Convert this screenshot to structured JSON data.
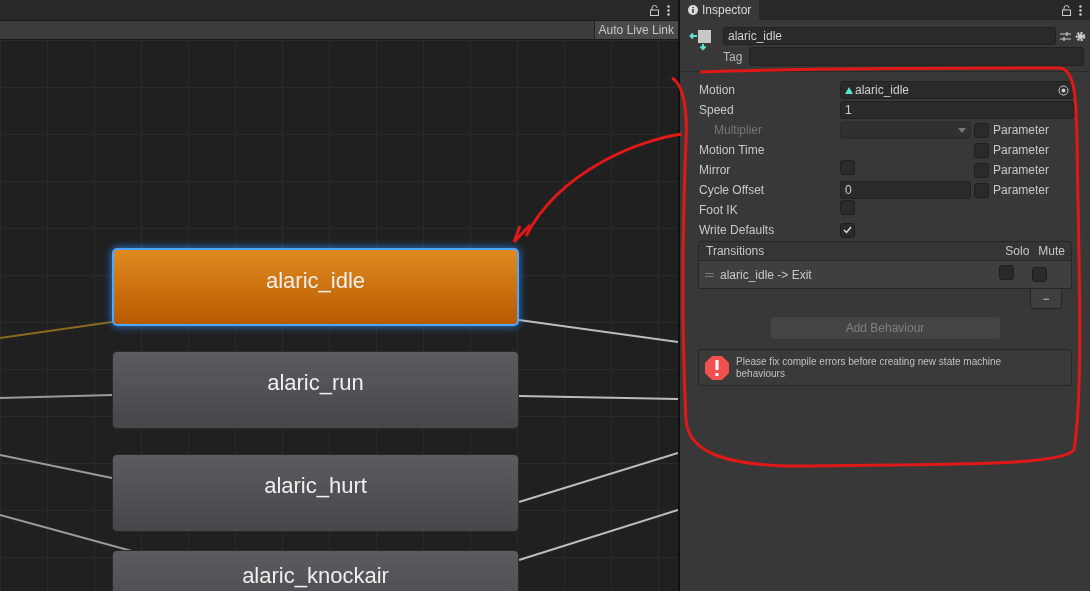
{
  "graph": {
    "toolbar_button": "Auto Live Link",
    "states": [
      {
        "name": "alaric_idle",
        "selected": true
      },
      {
        "name": "alaric_run",
        "selected": false
      },
      {
        "name": "alaric_hurt",
        "selected": false
      },
      {
        "name": "alaric_knockair",
        "selected": false
      }
    ]
  },
  "inspector": {
    "tab": "Inspector",
    "name": "alaric_idle",
    "tag_label": "Tag",
    "properties": [
      {
        "kind": "object",
        "label": "Motion",
        "value": "alaric_idle"
      },
      {
        "kind": "text",
        "label": "Speed",
        "value": "1"
      },
      {
        "kind": "dropdown",
        "label": "Multiplier",
        "disabled": true,
        "parameter": {
          "label": "Parameter",
          "checked": false
        }
      },
      {
        "kind": "none",
        "label": "Motion Time",
        "parameter": {
          "label": "Parameter",
          "checked": false
        }
      },
      {
        "kind": "checkbox",
        "label": "Mirror",
        "checked": false,
        "parameter": {
          "label": "Parameter",
          "checked": false
        }
      },
      {
        "kind": "text",
        "label": "Cycle Offset",
        "value": "0",
        "parameter": {
          "label": "Parameter",
          "checked": false
        }
      },
      {
        "kind": "checkbox",
        "label": "Foot IK",
        "checked": false
      },
      {
        "kind": "checkbox",
        "label": "Write Defaults",
        "checked": true
      }
    ],
    "transitions": {
      "title": "Transitions",
      "solo": "Solo",
      "mute": "Mute",
      "rows": [
        {
          "label": "alaric_idle -> Exit",
          "solo": false,
          "mute": false
        }
      ],
      "remove_button": "−"
    },
    "add_behaviour": {
      "label": "Add Behaviour",
      "disabled": true
    },
    "error": "Please fix compile errors before creating new state machine behaviours"
  }
}
